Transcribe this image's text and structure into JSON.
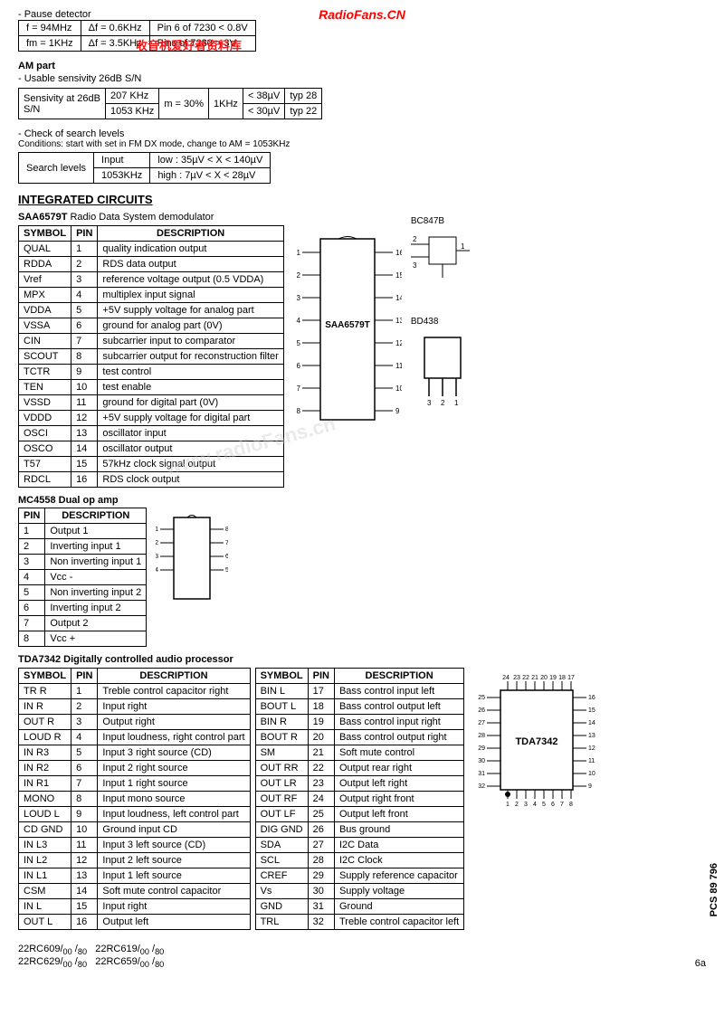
{
  "radiofans": {
    "title": "RadioFans.CN",
    "subtitle": "收音机爱好者资料库"
  },
  "pause_section": {
    "label": "- Pause detector",
    "rows": [
      {
        "col1": "f = 94MHz",
        "col2": "Δf = 0.6KHz",
        "col3": "Pin 6 of 7230 < 0.8V"
      },
      {
        "col1": "fm = 1KHz",
        "col2": "Δf = 3.5KHz",
        "col3": "Pins of 7230 > 3V"
      }
    ]
  },
  "am_part": {
    "label": "AM part",
    "usable": "- Usable sensivity 26dB S/N",
    "table": {
      "headers": [
        "Sensivity at 26dB S/N",
        "207 KHz",
        "m = 30%",
        "1KHz",
        "< 38µV",
        "typ 28"
      ],
      "row2": [
        "",
        "1053 KHz",
        "",
        "",
        "< 30µV",
        "typ 22"
      ]
    }
  },
  "search_levels": {
    "check_label": "- Check of search levels",
    "conditions": "Conditions: start with set in FM DX mode, change to AM = 1053KHz",
    "label": "Search levels",
    "input_label": "Input",
    "freq": "1053KHz",
    "low": "low : 35µV < X < 140µV",
    "high": "high : 7µV < X < 28µV"
  },
  "integrated_circuits": {
    "title": "INTEGRATED CIRCUITS",
    "saa6579t": {
      "name": "SAA6579T",
      "desc": "Radio Data System demodulator",
      "columns": [
        "SYMBOL",
        "PIN",
        "DESCRIPTION"
      ],
      "rows": [
        [
          "QUAL",
          "1",
          "quality indication output"
        ],
        [
          "RDDA",
          "2",
          "RDS data output"
        ],
        [
          "Vref",
          "3",
          "reference voltage output (0.5 VDDA)"
        ],
        [
          "MPX",
          "4",
          "multiplex input signal"
        ],
        [
          "VDDA",
          "5",
          "+5V supply voltage for analog part"
        ],
        [
          "VSSA",
          "6",
          "ground for analog part (0V)"
        ],
        [
          "CIN",
          "7",
          "subcarrier input to comparator"
        ],
        [
          "SCOUT",
          "8",
          "subcarrier output for reconstruction filter"
        ],
        [
          "TCTR",
          "9",
          "test control"
        ],
        [
          "TEN",
          "10",
          "test enable"
        ],
        [
          "VSSD",
          "11",
          "ground for digital part (0V)"
        ],
        [
          "VDDD",
          "12",
          "+5V supply voltage for digital part"
        ],
        [
          "OSCI",
          "13",
          "oscillator input"
        ],
        [
          "OSCO",
          "14",
          "oscillator output"
        ],
        [
          "T57",
          "15",
          "57kHz clock signal output"
        ],
        [
          "RDCL",
          "16",
          "RDS clock output"
        ]
      ]
    },
    "mc4558": {
      "name": "MC4558",
      "desc": "Dual op amp",
      "columns": [
        "PIN",
        "DESCRIPTION"
      ],
      "rows": [
        [
          "1",
          "Output 1"
        ],
        [
          "2",
          "Inverting input 1"
        ],
        [
          "3",
          "Non inverting input 1"
        ],
        [
          "4",
          "Vcc -"
        ],
        [
          "5",
          "Non inverting input 2"
        ],
        [
          "6",
          "Inverting input 2"
        ],
        [
          "7",
          "Output 2"
        ],
        [
          "8",
          "Vcc +"
        ]
      ]
    },
    "tda7342": {
      "name": "TDA7342",
      "desc": "Digitally controlled audio processor",
      "columns": [
        "SYMBOL",
        "PIN",
        "DESCRIPTION"
      ],
      "rows_left": [
        [
          "TR R",
          "1",
          "Treble control capacitor right"
        ],
        [
          "IN R",
          "2",
          "Input right"
        ],
        [
          "OUT R",
          "3",
          "Output right"
        ],
        [
          "LOUD R",
          "4",
          "Input loudness, right control part"
        ],
        [
          "IN R3",
          "5",
          "Input 3 right source (CD)"
        ],
        [
          "IN R2",
          "6",
          "Input 2 right source"
        ],
        [
          "IN R1",
          "7",
          "Input 1 right source"
        ],
        [
          "MONO",
          "8",
          "Input mono source"
        ],
        [
          "LOUD L",
          "9",
          "Input loudness, left control part"
        ],
        [
          "CD GND",
          "10",
          "Ground input CD"
        ],
        [
          "IN L3",
          "11",
          "Input 3 left source (CD)"
        ],
        [
          "IN L2",
          "12",
          "Input 2 left source"
        ],
        [
          "IN L1",
          "13",
          "Input 1 left source"
        ],
        [
          "CSM",
          "14",
          "Soft mute control capacitor"
        ],
        [
          "IN L",
          "15",
          "Input right"
        ],
        [
          "OUT L",
          "16",
          "Output left"
        ]
      ],
      "rows_right": [
        [
          "BIN L",
          "17",
          "Bass control input left"
        ],
        [
          "BOUT L",
          "18",
          "Bass control output left"
        ],
        [
          "BIN R",
          "19",
          "Bass control input right"
        ],
        [
          "BOUT R",
          "20",
          "Bass control output right"
        ],
        [
          "SM",
          "21",
          "Soft mute control"
        ],
        [
          "OUT RR",
          "22",
          "Output rear right"
        ],
        [
          "OUT LR",
          "23",
          "Output left right"
        ],
        [
          "OUT RF",
          "24",
          "Output right front"
        ],
        [
          "OUT LF",
          "25",
          "Output left front"
        ],
        [
          "DIG GND",
          "26",
          "Bus ground"
        ],
        [
          "SDA",
          "27",
          "I2C Data"
        ],
        [
          "SCL",
          "28",
          "I2C Clock"
        ],
        [
          "CREF",
          "29",
          "Supply reference capacitor"
        ],
        [
          "Vs",
          "30",
          "Supply voltage"
        ],
        [
          "GND",
          "31",
          "Ground"
        ],
        [
          "TRL",
          "32",
          "Treble control capacitor left"
        ]
      ]
    }
  },
  "transistors": {
    "bc847b": "BC847B",
    "bd438": "BD438"
  },
  "bottom": {
    "part_numbers": [
      "22RC609/00 /80  22RC619/00 /80",
      "22RC629/00 /80  22RC659/00 /80"
    ],
    "page": "6a",
    "pcs": "PCS 89 796"
  }
}
